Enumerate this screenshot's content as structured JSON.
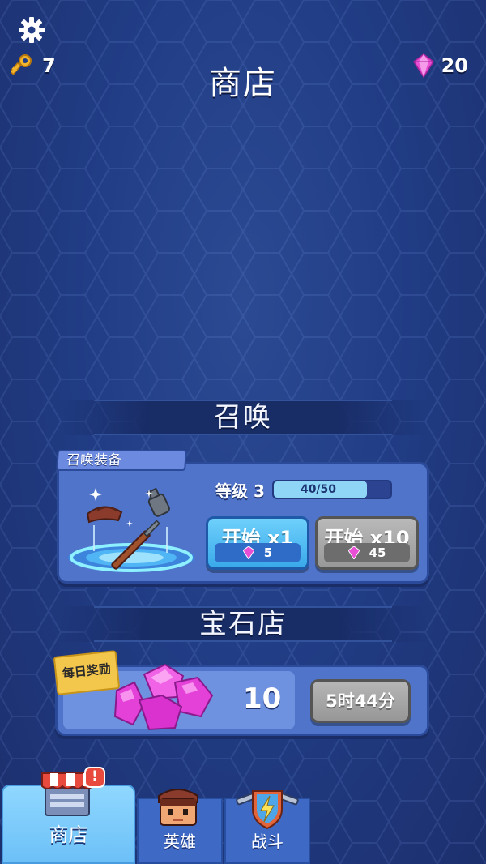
{
  "header": {
    "title": "商店",
    "keys": "7",
    "gems": "20"
  },
  "summon": {
    "section_title": "召唤",
    "tag": "召唤装备",
    "level_label": "等级",
    "level_value": "3",
    "progress_text": "40/50",
    "progress_fraction": 0.8,
    "btn_x1_label": "开始 x1",
    "btn_x1_cost": "5",
    "btn_x10_label": "开始 x10",
    "btn_x10_cost": "45"
  },
  "gem_shop": {
    "section_title": "宝石店",
    "daily_tag": "每日奖励",
    "amount": "10",
    "timer": "5时44分"
  },
  "nav": {
    "shop": "商店",
    "hero": "英雄",
    "battle": "战斗",
    "shop_badge": "!"
  },
  "colors": {
    "background": "#213d85",
    "card": "#4f74c9",
    "accent_blue": "#3aa9ea",
    "gem_pink": "#e84fd4",
    "key_gold": "#f2b52d"
  }
}
